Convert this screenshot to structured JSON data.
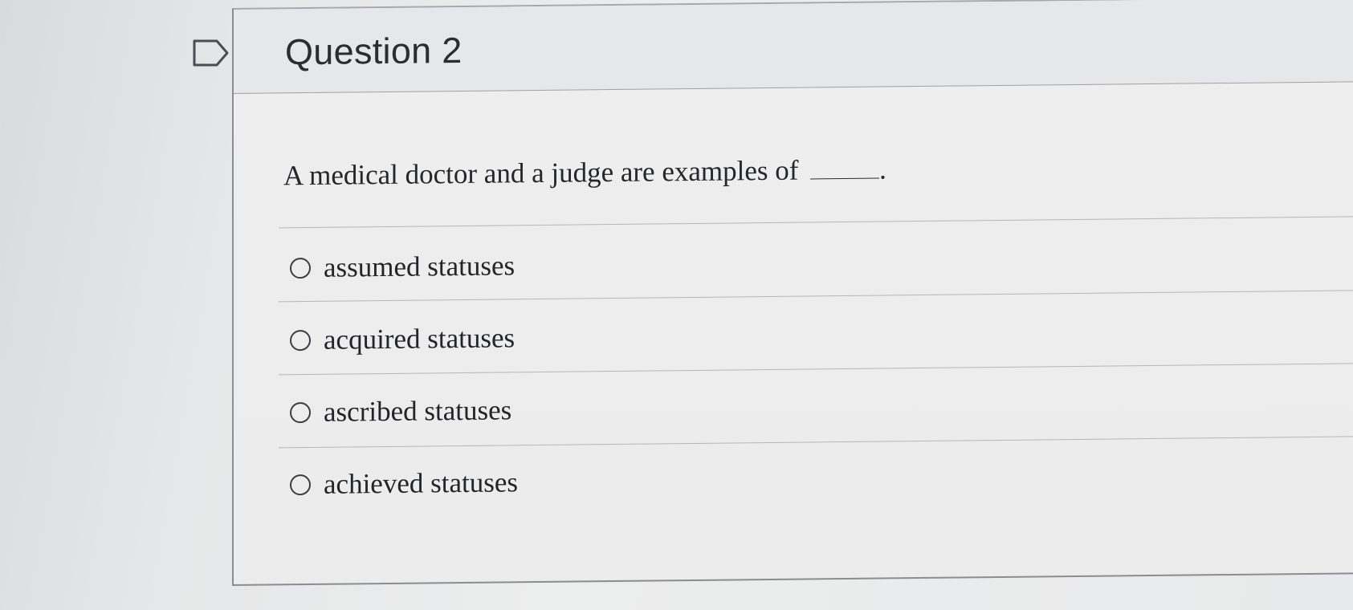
{
  "question": {
    "title": "Question 2",
    "prompt": "A medical doctor and a judge are examples of",
    "prompt_end": "."
  },
  "options": [
    {
      "label": "assumed statuses",
      "selected": false
    },
    {
      "label": "acquired statuses",
      "selected": false
    },
    {
      "label": "ascribed statuses",
      "selected": false
    },
    {
      "label": "achieved statuses",
      "selected": false
    }
  ],
  "icons": {
    "flag": "flag-icon",
    "radio": "radio-button-icon"
  },
  "colors": {
    "background": "#e6e7e8",
    "card_border": "#8a8d91",
    "text": "#25272a"
  }
}
